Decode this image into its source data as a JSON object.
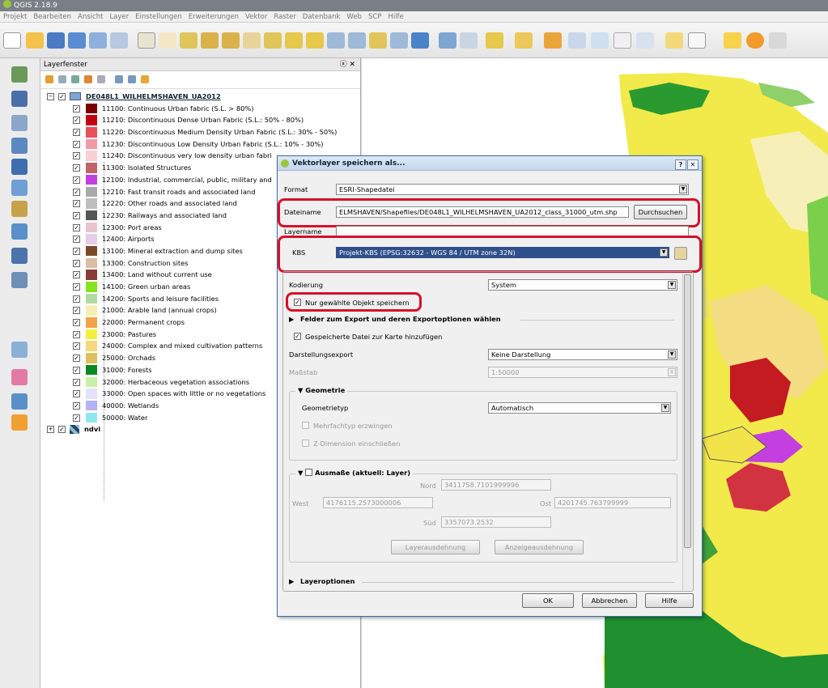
{
  "app": {
    "title": "QGIS 2.18.9"
  },
  "menu": [
    "Projekt",
    "Bearbeiten",
    "Ansicht",
    "Layer",
    "Einstellungen",
    "Erweiterungen",
    "Vektor",
    "Raster",
    "Datenbank",
    "Web",
    "SCP",
    "Hilfe"
  ],
  "layer_panel": {
    "title": "Layerfenster",
    "close_glyph": "ⓧ ✕",
    "group_name": "DE048L1_WILHELMSHAVEN_UA2012",
    "classes": [
      {
        "label": "11100: Continuous Urban fabric (S.L. > 80%)",
        "color": "#7a0000"
      },
      {
        "label": "11210: Discontinuous Dense Urban Fabric (S.L.: 50% - 80%)",
        "color": "#c40010"
      },
      {
        "label": "11220: Discontinuous Medium Density Urban Fabric (S.L.: 30% - 50%)",
        "color": "#e8505a"
      },
      {
        "label": "11230: Discontinuous Low Density Urban Fabric (S.L.: 10% - 30%)",
        "color": "#f29aa2"
      },
      {
        "label": "11240: Discontinuous very low density urban fabri",
        "color": "#f8cfd2"
      },
      {
        "label": "11300: Isolated Structures",
        "color": "#c0646c"
      },
      {
        "label": "12100: Industrial, commercial, public, military and",
        "color": "#c33fe0"
      },
      {
        "label": "12210: Fast transit roads and associated land",
        "color": "#a9a9a9"
      },
      {
        "label": "12220: Other roads and associated land",
        "color": "#bebebe"
      },
      {
        "label": "12230: Railways and associated land",
        "color": "#555555"
      },
      {
        "label": "12300: Port areas",
        "color": "#e9c4cf"
      },
      {
        "label": "12400: Airports",
        "color": "#e6cce6"
      },
      {
        "label": "13100: Mineral extraction and dump sites",
        "color": "#7a4a28"
      },
      {
        "label": "13300: Construction sites",
        "color": "#d9bda5"
      },
      {
        "label": "13400: Land without current use",
        "color": "#8a3c3c"
      },
      {
        "label": "14100: Green urban areas",
        "color": "#86e31f"
      },
      {
        "label": "14200: Sports and leisure facilities",
        "color": "#b3d9a3"
      },
      {
        "label": "21000: Arable land (annual crops)",
        "color": "#f5efb5"
      },
      {
        "label": "22000: Permanent crops",
        "color": "#f2a24a"
      },
      {
        "label": "23000: Pastures",
        "color": "#f4ef3b"
      },
      {
        "label": "24000: Complex and mixed cultivation patterns",
        "color": "#f5d77c"
      },
      {
        "label": "25000: Orchads",
        "color": "#dcc15e"
      },
      {
        "label": "31000: Forests",
        "color": "#0a8a1e"
      },
      {
        "label": "32000: Herbaceous vegetation associations",
        "color": "#c9f0a6"
      },
      {
        "label": "33000: Open spaces with little or no vegetations",
        "color": "#e2e2ff"
      },
      {
        "label": "40000: Wetlands",
        "color": "#b2b2f5"
      },
      {
        "label": "50000: Water",
        "color": "#8fe8ec"
      }
    ],
    "second_layer": "ndvi"
  },
  "dialog": {
    "title": "Vektorlayer speichern als...",
    "help_glyph": "?",
    "close_glyph": "✕",
    "format_label": "Format",
    "format_value": "ESRI-Shapedatei",
    "filename_label": "Dateiname",
    "filename_value": "ELMSHAVEN/Shapefiles/DE048L1_WILHELMSHAVEN_UA2012_class_31000_utm.shp",
    "browse_button": "Durchsuchen",
    "layername_label": "Layername",
    "crs_label": "KBS",
    "crs_value": "Projekt-KBS (EPSG:32632 - WGS 84 / UTM zone 32N)",
    "encoding_label": "Kodierung",
    "encoding_value": "System",
    "only_selected_label": "Nur gewählte Objekt speichern",
    "fields_section": "Felder zum Export und deren Exportoptionen wählen",
    "add_to_map_label": "Gespeicherte Datei zur Karte hinzufügen",
    "symbology_label": "Darstellungsexport",
    "symbology_value": "Keine Darstellung",
    "scale_label": "Maßstab",
    "scale_value": "1:50000",
    "geometry_section": "Geometrie",
    "geometry_type_label": "Geometrietyp",
    "geometry_type_value": "Automatisch",
    "force_multi_label": "Mehrfachtyp erzwingen",
    "z_dim_label": "Z-Dimension einschließen",
    "extent_section": "Ausmaße (aktuell: Layer)",
    "north_label": "Nord",
    "north_value": "3411758.7101999996",
    "west_label": "West",
    "west_value": "4176115.2573000006",
    "east_label": "Ost",
    "east_value": "4201745.763799999",
    "south_label": "Süd",
    "south_value": "3357073.2532",
    "layer_extent_button": "Layerausdehnung",
    "canvas_extent_button": "Anzeigeausdehnung",
    "layer_options_section": "Layeroptionen",
    "ok_button": "OK",
    "cancel_button": "Abbrechen",
    "help_button": "Hilfe"
  }
}
